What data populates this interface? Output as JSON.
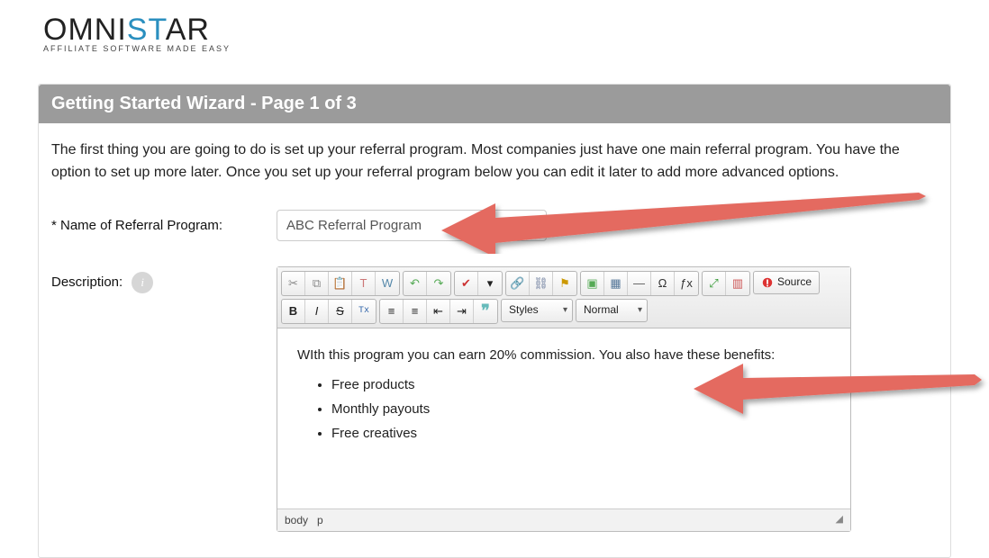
{
  "logo": {
    "omni": "OMNI",
    "st": "ST",
    "ar": "AR",
    "tagline": "AFFILIATE SOFTWARE MADE EASY"
  },
  "panel": {
    "title": "Getting Started Wizard - Page 1 of 3",
    "intro": "The first thing you are going to do is set up your referral program. Most companies just have one main referral program. You have the option to set up more later. Once you set up your referral program below you can edit it later to add more advanced options."
  },
  "form": {
    "name_label": "* Name of Referral Program:",
    "name_value": "ABC Referral Program",
    "description_label": "Description:",
    "info_char": "i"
  },
  "editor": {
    "styles_label": "Styles",
    "format_label": "Normal",
    "source_label": "Source",
    "content_p": "WIth this program you can earn 20% commission. You also have these benefits:",
    "content_items": [
      "Free products",
      "Monthly payouts",
      "Free creatives"
    ],
    "footer_path": [
      "body",
      "p"
    ],
    "resize_glyph": "◢",
    "icons": {
      "cut": "✂",
      "copy": "⧉",
      "paste": "📋",
      "paste_text": "T",
      "paste_word": "W",
      "undo": "↶",
      "redo": "↷",
      "spell": "✔",
      "scayt": "▾",
      "link": "🔗",
      "unlink": "⛓",
      "anchor": "⚑",
      "image": "▣",
      "table": "▦",
      "hr": "―",
      "omega": "Ω",
      "fx": "ƒx",
      "maximize": "⤢",
      "blocks": "▥",
      "bold": "B",
      "italic": "I",
      "strike": "S",
      "removefmt": "Tx",
      "ol": "≡",
      "ul": "≡",
      "outdent": "⇤",
      "indent": "⇥",
      "quote": "❞"
    }
  }
}
